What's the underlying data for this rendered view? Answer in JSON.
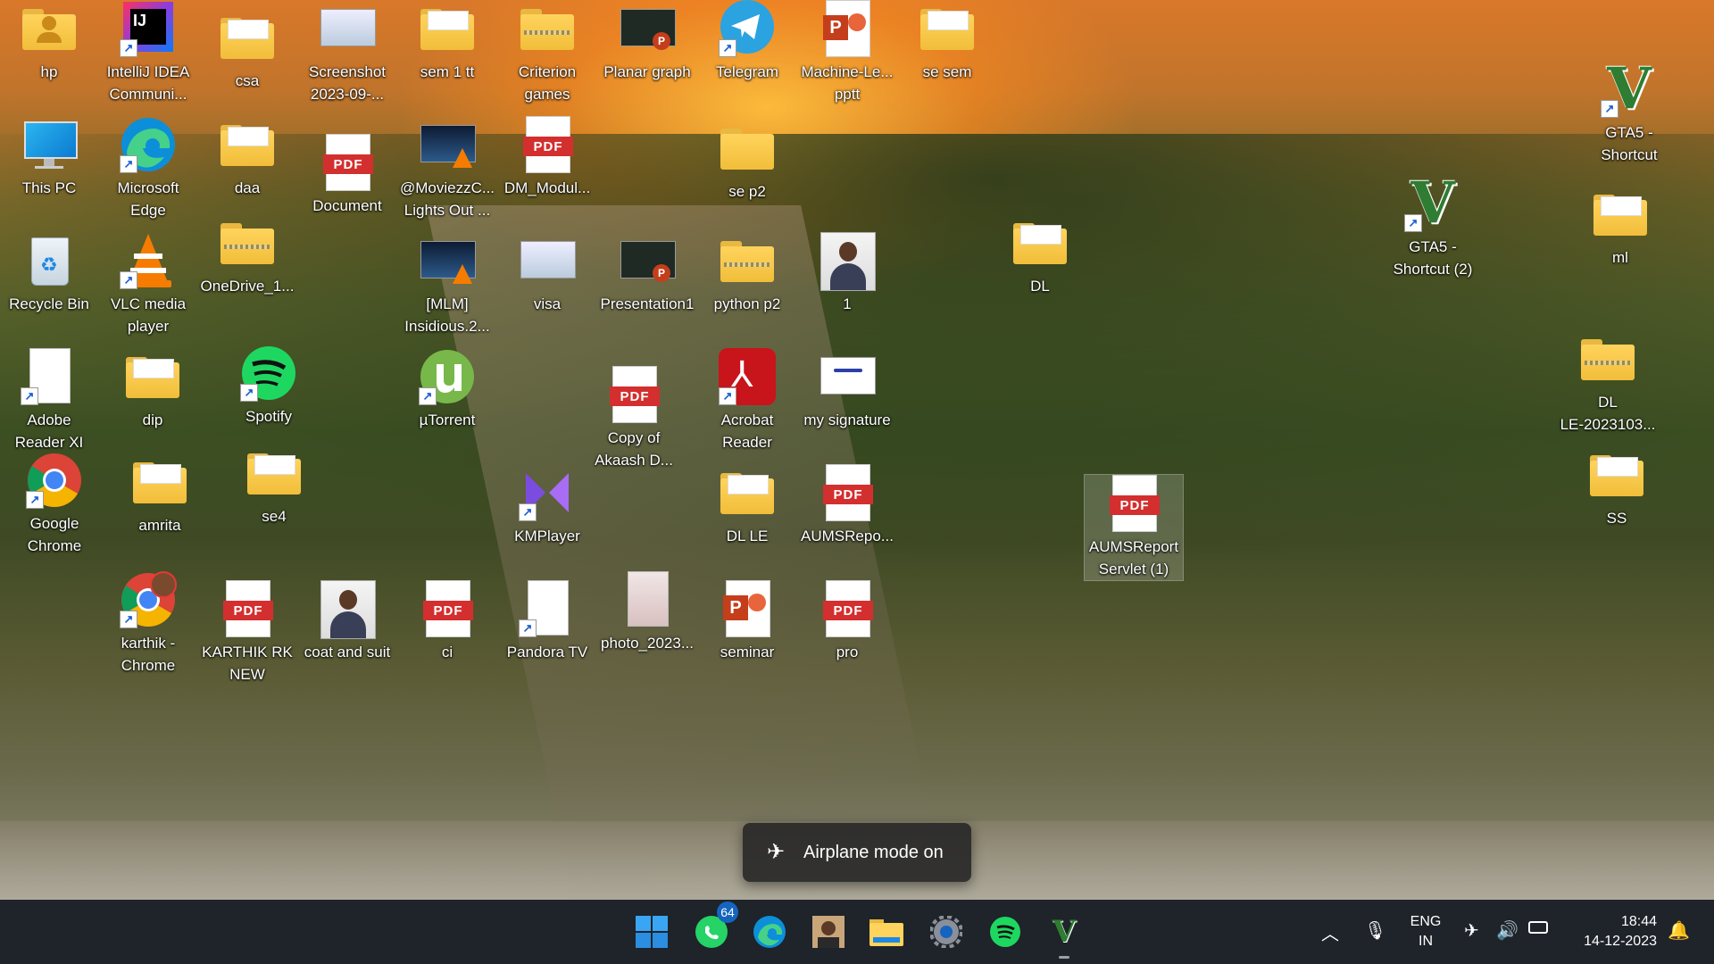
{
  "desktop": {
    "icons": [
      {
        "label": "hp",
        "type": "folder-user"
      },
      {
        "label": "IntelliJ IDEA\nCommuni...",
        "type": "app-intellij"
      },
      {
        "label": "csa",
        "type": "folder"
      },
      {
        "label": "Screenshot\n2023-09-...",
        "type": "image"
      },
      {
        "label": "sem 1 tt",
        "type": "folder"
      },
      {
        "label": "Criterion\ngames",
        "type": "folder-zip"
      },
      {
        "label": "Planar  graph",
        "type": "pptx"
      },
      {
        "label": "Telegram",
        "type": "app-telegram"
      },
      {
        "label": "Machine-Le...\npptt",
        "type": "pptx-file"
      },
      {
        "label": "se sem",
        "type": "folder"
      },
      {
        "label": "GTA5 -\nShortcut",
        "type": "app-gta"
      },
      {
        "label": "This PC",
        "type": "this-pc"
      },
      {
        "label": "Microsoft\nEdge",
        "type": "app-edge"
      },
      {
        "label": "daa",
        "type": "folder"
      },
      {
        "label": "Document",
        "type": "pdf"
      },
      {
        "label": "@MoviezzC...\nLights Out ...",
        "type": "video"
      },
      {
        "label": "DM_Modul...",
        "type": "pdf"
      },
      {
        "label": "se p2",
        "type": "folder-plain"
      },
      {
        "label": "GTA5 -\nShortcut (2)",
        "type": "app-gta"
      },
      {
        "label": "ml",
        "type": "folder"
      },
      {
        "label": "Recycle Bin",
        "type": "recycle"
      },
      {
        "label": "VLC media\nplayer",
        "type": "app-vlc"
      },
      {
        "label": "OneDrive_1...",
        "type": "folder-zip"
      },
      {
        "label": "[MLM]\nInsidious.2...",
        "type": "video"
      },
      {
        "label": "visa",
        "type": "image"
      },
      {
        "label": "Presentation1",
        "type": "pptx"
      },
      {
        "label": "python p2",
        "type": "folder-zip"
      },
      {
        "label": "1",
        "type": "photo"
      },
      {
        "label": "DL",
        "type": "folder"
      },
      {
        "label": "DL\nLE-2023103...",
        "type": "folder-zip"
      },
      {
        "label": "Adobe\nReader XI",
        "type": "doc"
      },
      {
        "label": "dip",
        "type": "folder"
      },
      {
        "label": "Spotify",
        "type": "app-spotify"
      },
      {
        "label": "µTorrent",
        "type": "app-utorrent"
      },
      {
        "label": "Copy of\nAkaash D...",
        "type": "pdf"
      },
      {
        "label": "Acrobat\nReader",
        "type": "app-acrobat"
      },
      {
        "label": "my signature",
        "type": "image-sig"
      },
      {
        "label": "AUMSReport\nServlet (1)",
        "type": "pdf"
      },
      {
        "label": "SS",
        "type": "folder"
      },
      {
        "label": "Google\nChrome",
        "type": "app-chrome"
      },
      {
        "label": "amrita",
        "type": "folder"
      },
      {
        "label": "se4",
        "type": "folder"
      },
      {
        "label": "KMPlayer",
        "type": "app-kmplayer"
      },
      {
        "label": "DL LE",
        "type": "folder"
      },
      {
        "label": "AUMSRepo...",
        "type": "pdf"
      },
      {
        "label": "karthik -\nChrome",
        "type": "app-chrome-profile"
      },
      {
        "label": "KARTHIK RK\nNEW",
        "type": "pdf"
      },
      {
        "label": "coat and suit",
        "type": "photo"
      },
      {
        "label": "ci",
        "type": "pdf"
      },
      {
        "label": "Pandora TV",
        "type": "doc"
      },
      {
        "label": "photo_2023...",
        "type": "image-doc"
      },
      {
        "label": "seminar",
        "type": "pptx-file"
      },
      {
        "label": "pro",
        "type": "pdf"
      }
    ]
  },
  "toast": {
    "icon": "airplane-icon",
    "text": "Airplane mode on"
  },
  "taskbar": {
    "apps": [
      {
        "name": "start-button",
        "icon": "windows-logo-icon"
      },
      {
        "name": "whatsapp",
        "icon": "whatsapp-icon",
        "badge": "64"
      },
      {
        "name": "edge",
        "icon": "edge-icon"
      },
      {
        "name": "photo-app",
        "icon": "profile-photo-icon"
      },
      {
        "name": "file-explorer",
        "icon": "folder-icon"
      },
      {
        "name": "settings",
        "icon": "gear-icon"
      },
      {
        "name": "spotify",
        "icon": "spotify-icon"
      },
      {
        "name": "gta5",
        "icon": "gta-v-icon"
      }
    ],
    "tray": {
      "language_top": "ENG",
      "language_bottom": "IN",
      "time": "18:44",
      "date": "14-12-2023"
    }
  },
  "colors": {
    "taskbar": "#1f232a",
    "accent": "#1565c0",
    "pdf_red": "#d32f2f",
    "folder_yellow": "#ffd35c"
  }
}
